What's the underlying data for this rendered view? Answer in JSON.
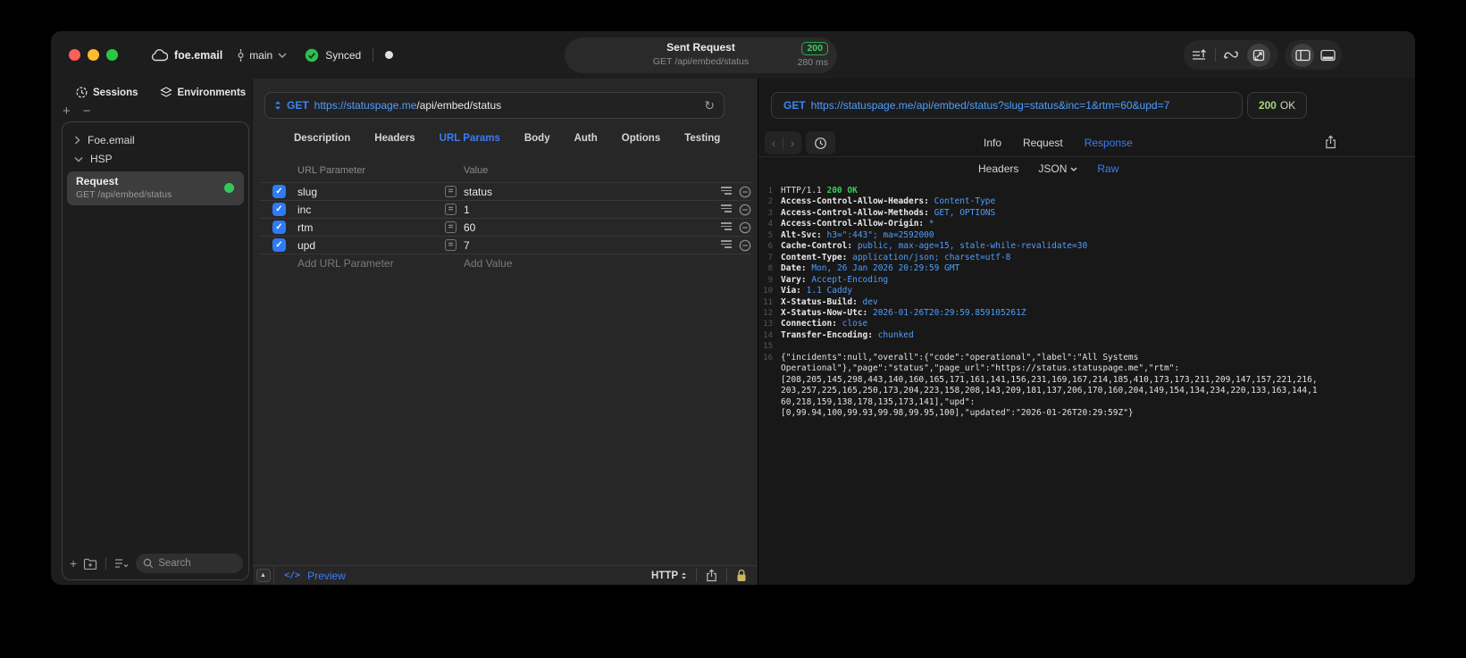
{
  "titlebar": {
    "project": "foe.email",
    "branch": "main",
    "sync_label": "Synced",
    "request_pill": {
      "title": "Sent Request",
      "subtitle": "GET /api/embed/status",
      "status": "200",
      "duration": "280 ms"
    }
  },
  "sidebar": {
    "tabs": [
      {
        "label": "Sessions"
      },
      {
        "label": "Environments"
      }
    ],
    "tree": [
      {
        "label": "Foe.email",
        "state": "collapsed"
      },
      {
        "label": "HSP",
        "state": "expanded"
      }
    ],
    "request_item": {
      "title": "Request",
      "subtitle": "GET /api/embed/status"
    },
    "search_placeholder": "Search"
  },
  "request_editor": {
    "method": "GET",
    "url_host": "https://statuspage.me",
    "url_path": "/api/embed/status",
    "tabs": [
      "Description",
      "Headers",
      "URL Params",
      "Body",
      "Auth",
      "Options",
      "Testing"
    ],
    "active_tab": "URL Params",
    "params": {
      "columns": {
        "name": "URL Parameter",
        "value": "Value"
      },
      "rows": [
        {
          "name": "slug",
          "value": "status",
          "enabled": true
        },
        {
          "name": "inc",
          "value": "1",
          "enabled": true
        },
        {
          "name": "rtm",
          "value": "60",
          "enabled": true
        },
        {
          "name": "upd",
          "value": "7",
          "enabled": true
        }
      ],
      "add_name": "Add URL Parameter",
      "add_value": "Add Value"
    },
    "footer": {
      "code_glyph": "</>",
      "preview_label": "Preview",
      "protocol": "HTTP"
    }
  },
  "response_viewer": {
    "method": "GET",
    "url": "https://statuspage.me/api/embed/status?slug=status&inc=1&rtm=60&upd=7",
    "status_code": "200",
    "status_text": "OK",
    "tabs": [
      "Info",
      "Request",
      "Response"
    ],
    "active_tab": "Response",
    "subtabs": [
      "Headers",
      "JSON",
      "Raw"
    ],
    "active_subtab": "Raw",
    "status_line": {
      "protocol": "HTTP/1.1",
      "status": "200 OK"
    },
    "headers": [
      {
        "name": "Access-Control-Allow-Headers",
        "value": "Content-Type"
      },
      {
        "name": "Access-Control-Allow-Methods",
        "value": "GET, OPTIONS"
      },
      {
        "name": "Access-Control-Allow-Origin",
        "value": "*"
      },
      {
        "name": "Alt-Svc",
        "value": "h3=\":443\"; ma=2592000"
      },
      {
        "name": "Cache-Control",
        "value": "public, max-age=15, stale-while-revalidate=30"
      },
      {
        "name": "Content-Type",
        "value": "application/json; charset=utf-8"
      },
      {
        "name": "Date",
        "value": "Mon, 26 Jan 2026 20:29:59 GMT"
      },
      {
        "name": "Vary",
        "value": "Accept-Encoding"
      },
      {
        "name": "Via",
        "value": "1.1 Caddy"
      },
      {
        "name": "X-Status-Build",
        "value": "dev"
      },
      {
        "name": "X-Status-Now-Utc",
        "value": "2026-01-26T20:29:59.859105261Z"
      },
      {
        "name": "Connection",
        "value": "close"
      },
      {
        "name": "Transfer-Encoding",
        "value": "chunked"
      }
    ],
    "body_lines": [
      "{\"incidents\":null,\"overall\":{\"code\":\"operational\",\"label\":\"All Systems",
      "Operational\"},\"page\":\"status\",\"page_url\":\"https://status.statuspage.me\",\"rtm\":",
      "[208,205,145,298,443,140,160,165,171,161,141,156,231,169,167,214,185,410,173,173,211,209,147,157,221,216,",
      "203,257,225,165,250,173,204,223,158,208,143,209,181,137,206,170,160,204,149,154,134,234,220,133,163,144,1",
      "60,218,159,138,178,135,173,141],\"upd\":",
      "[0,99.94,100,99.93,99.98,99.95,100],\"updated\":\"2026-01-26T20:29:59Z\"}"
    ]
  },
  "icons": {
    "check": "✓",
    "plus": "+",
    "minus": "−",
    "equals": "=",
    "triangle_up": "▲",
    "chevron_back": "‹",
    "chevron_forward": "›",
    "refresh": "↻"
  },
  "colors": {
    "accent_blue": "#3d7bf5",
    "code_blue": "#4d9eff",
    "status_green": "#33d158",
    "badge_green": "#36d158",
    "checkbox_blue": "#2e7bf6",
    "selected_row": "#3d3d3d"
  }
}
